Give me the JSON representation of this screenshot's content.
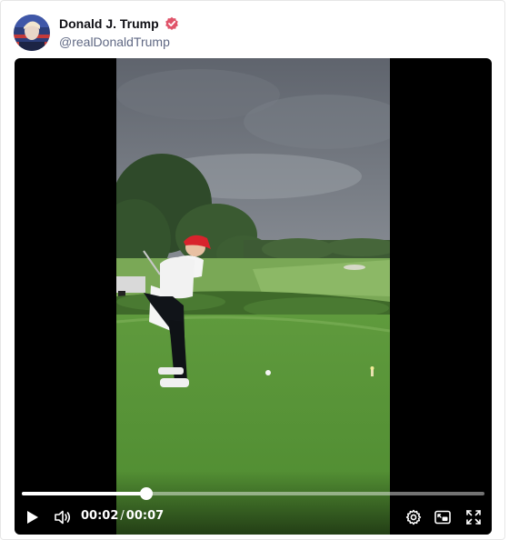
{
  "account": {
    "display_name": "Donald J. Trump",
    "handle": "@realDonaldTrump",
    "verified_icon": "verified-badge-icon",
    "verified_color": "#e0546a"
  },
  "video": {
    "current_time": "00:02",
    "separator": "/",
    "duration": "00:07",
    "progress": 0.27,
    "icons": {
      "play": "play-icon",
      "volume": "volume-icon",
      "settings": "gear-icon",
      "picture_in_picture": "picture-in-picture-icon",
      "fullscreen": "fullscreen-icon"
    }
  }
}
